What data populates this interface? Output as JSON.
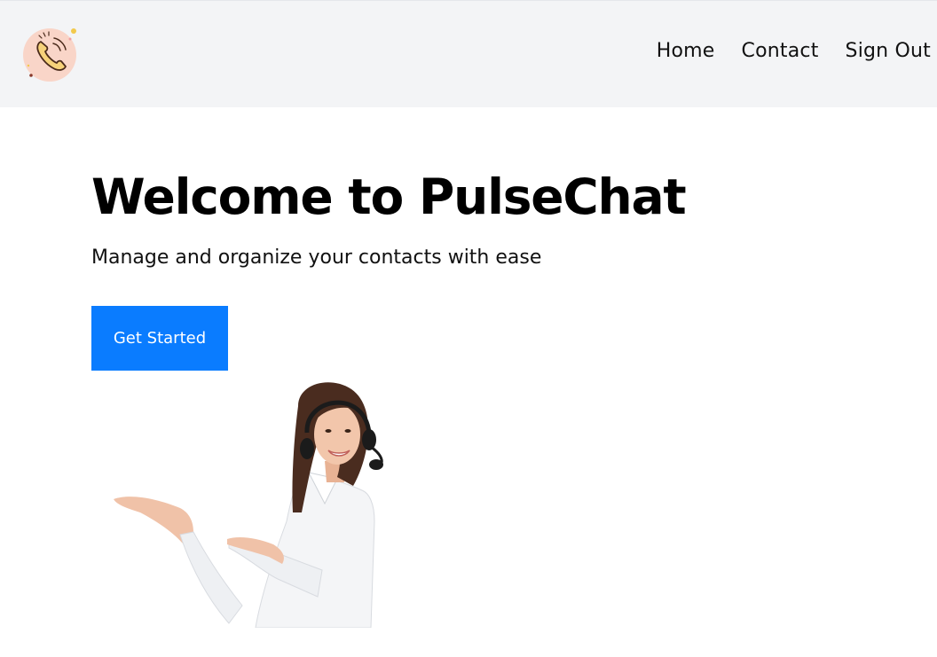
{
  "header": {
    "logo_icon": "phone-icon",
    "nav": [
      {
        "label": "Home"
      },
      {
        "label": "Contact"
      },
      {
        "label": "Sign Out"
      }
    ]
  },
  "hero": {
    "title": "Welcome to PulseChat",
    "subtitle": "Manage and organize your contacts with ease",
    "cta_label": "Get Started",
    "image_icon": "support-agent-image"
  },
  "colors": {
    "accent": "#0a7cff",
    "header_bg": "#f3f4f6",
    "logo_bg": "#f9d5c8",
    "logo_phone": "#f2c94c"
  }
}
